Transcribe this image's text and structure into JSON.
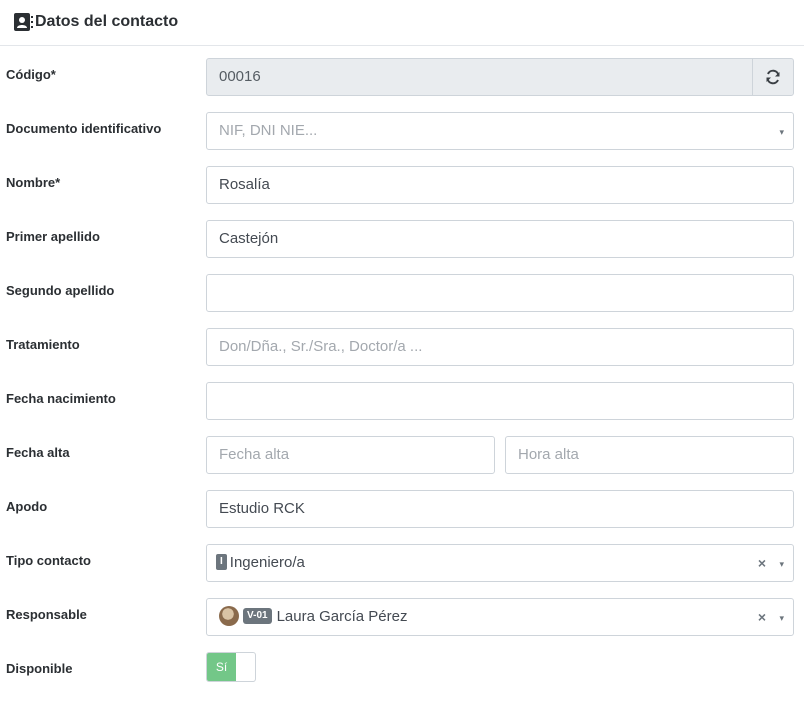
{
  "header": {
    "title": "Datos del contacto",
    "icon": "contact-book-icon"
  },
  "fields": {
    "codigo": {
      "label": "Código*",
      "value": "00016",
      "refresh_icon": "refresh-icon"
    },
    "documento": {
      "label": "Documento identificativo",
      "placeholder": "NIF, DNI NIE..."
    },
    "nombre": {
      "label": "Nombre*",
      "value": "Rosalía"
    },
    "primer_apellido": {
      "label": "Primer apellido",
      "value": "Castejón"
    },
    "segundo_apellido": {
      "label": "Segundo apellido",
      "value": ""
    },
    "tratamiento": {
      "label": "Tratamiento",
      "placeholder": "Don/Dña., Sr./Sra., Doctor/a ..."
    },
    "fecha_nacimiento": {
      "label": "Fecha nacimiento",
      "value": ""
    },
    "fecha_alta": {
      "label": "Fecha alta",
      "date_placeholder": "Fecha alta",
      "time_placeholder": "Hora alta"
    },
    "apodo": {
      "label": "Apodo",
      "value": "Estudio RCK"
    },
    "tipo_contacto": {
      "label": "Tipo contacto",
      "tag": "I",
      "value": "Ingeniero/a",
      "clear": "×",
      "caret": "▾"
    },
    "responsable": {
      "label": "Responsable",
      "code": "V-01",
      "value": "Laura García Pérez",
      "clear": "×",
      "caret": "▾"
    },
    "disponible": {
      "label": "Disponible",
      "toggle_label": "Sí",
      "state": "on"
    }
  },
  "colors": {
    "accent_green": "#73c788",
    "border": "#ced4da",
    "readonly_bg": "#e9ecef",
    "tag_gray": "#6c757d"
  }
}
